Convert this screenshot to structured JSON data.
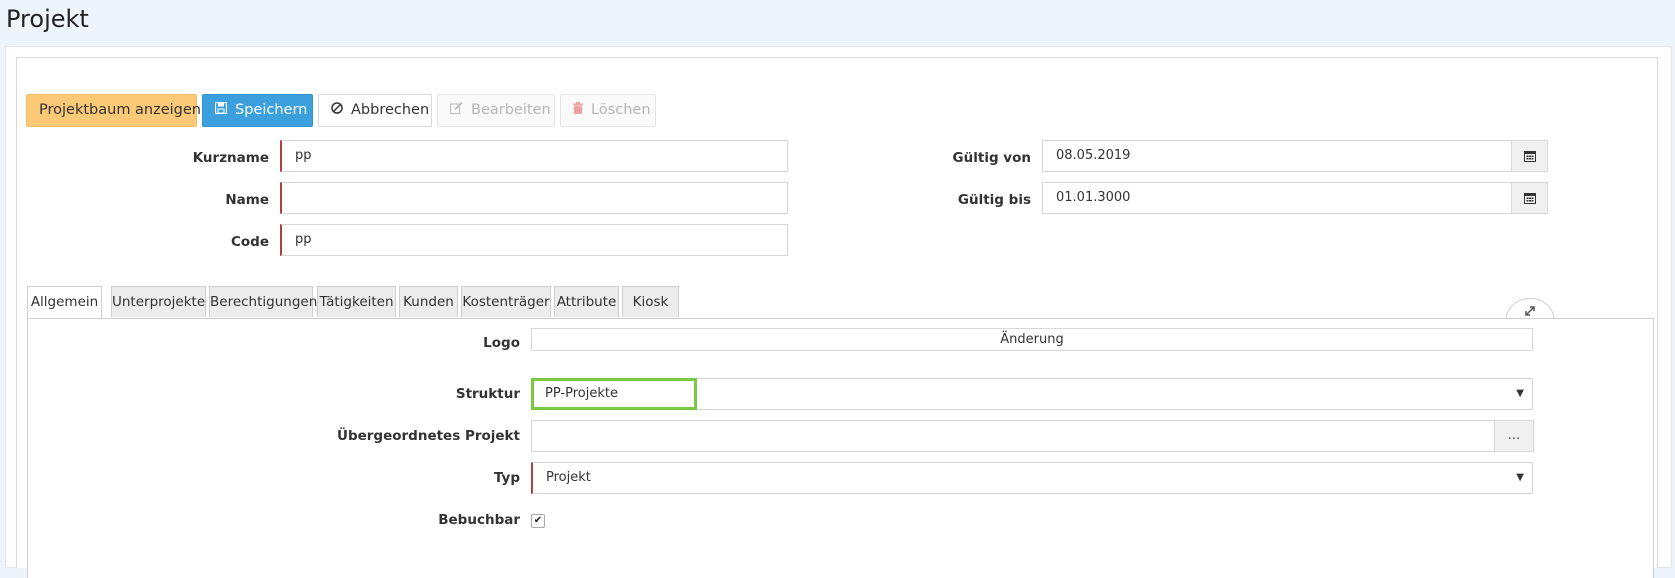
{
  "page": {
    "title": "Projekt"
  },
  "toolbar": {
    "tree_label": "Projektbaum anzeigen",
    "save_label": "Speichern",
    "cancel_label": "Abbrechen",
    "edit_label": "Bearbeiten",
    "delete_label": "Löschen"
  },
  "form": {
    "kurzname": {
      "label": "Kurzname",
      "value": "pp"
    },
    "name": {
      "label": "Name",
      "value": ""
    },
    "code": {
      "label": "Code",
      "value": "pp"
    },
    "gueltig_von": {
      "label": "Gültig von",
      "value": "08.05.2019"
    },
    "gueltig_bis": {
      "label": "Gültig bis",
      "value": "01.01.3000"
    }
  },
  "tabs": [
    "Allgemein",
    "Unterprojekte",
    "Berechtigungen",
    "Tätigkeiten",
    "Kunden",
    "Kostenträger",
    "Attribute",
    "Kiosk"
  ],
  "general": {
    "logo": {
      "label": "Logo",
      "button": "Änderung"
    },
    "struktur": {
      "label": "Struktur",
      "value": "PP-Projekte"
    },
    "parent": {
      "label": "Übergeordnetes Projekt",
      "value": "",
      "button": "..."
    },
    "typ": {
      "label": "Typ",
      "value": "Projekt"
    },
    "bebuchbar": {
      "label": "Bebuchbar",
      "checked": true
    }
  },
  "colors": {
    "yellow_button": "#fcca77",
    "blue_button": "#3ba0dd",
    "required_marker": "#a94442",
    "highlight": "#7ac943"
  }
}
